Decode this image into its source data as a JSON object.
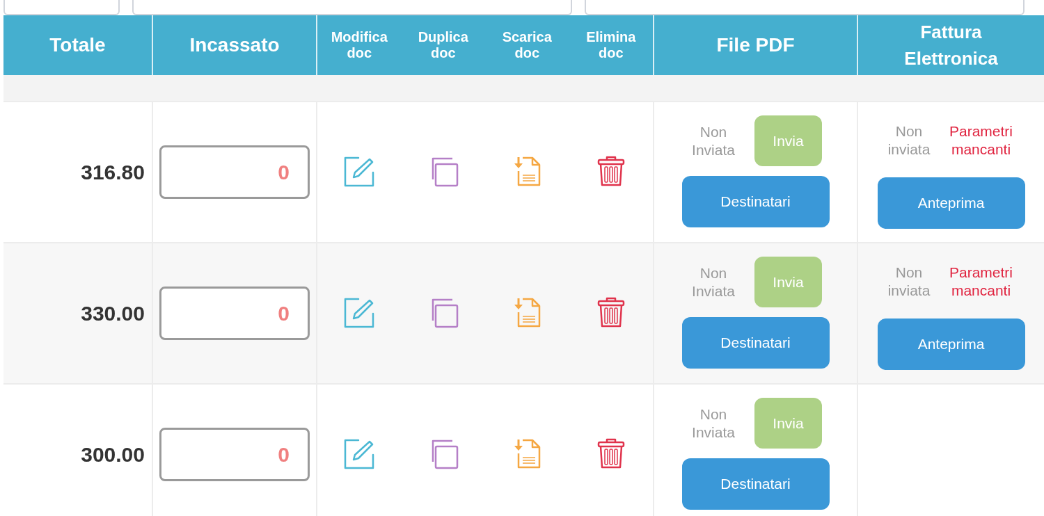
{
  "top_fields": [
    {
      "kind": "field"
    },
    {
      "kind": "field"
    },
    {
      "kind": "field"
    }
  ],
  "columns": {
    "totale": "Totale",
    "incassato": "Incassato",
    "actions": [
      "Modifica doc",
      "Duplica doc",
      "Scarica doc",
      "Elimina doc"
    ],
    "pdf": "File PDF",
    "fattura": "Fattura Elettronica"
  },
  "rows": [
    {
      "totale": "316.80",
      "incassato": "0",
      "pdf": {
        "status": "Non Inviata",
        "send": "Invia",
        "recipients": "Destinatari"
      },
      "fattura": {
        "status": "Non inviata",
        "error": "Parametri mancanti",
        "preview": "Anteprima"
      }
    },
    {
      "totale": "330.00",
      "incassato": "0",
      "pdf": {
        "status": "Non Inviata",
        "send": "Invia",
        "recipients": "Destinatari"
      },
      "fattura": {
        "status": "Non inviata",
        "error": "Parametri mancanti",
        "preview": "Anteprima"
      }
    },
    {
      "totale": "300.00",
      "incassato": "0",
      "pdf": {
        "status": "Non Inviata",
        "send": "Invia",
        "recipients": "Destinatari"
      },
      "fattura": null
    }
  ]
}
